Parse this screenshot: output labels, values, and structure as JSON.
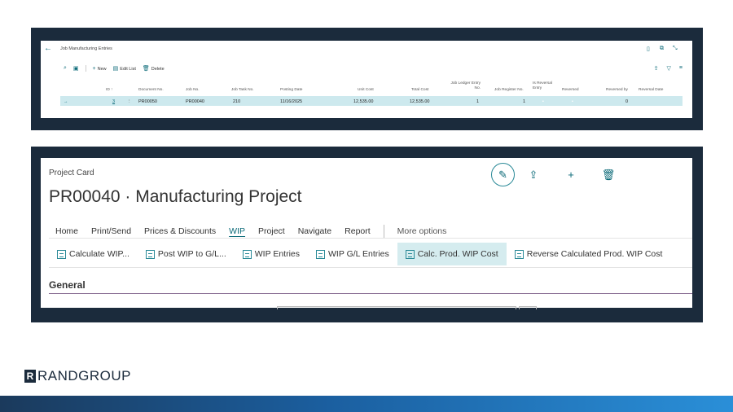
{
  "top": {
    "title": "Job Manufacturing Entries",
    "toolbar": {
      "new_label": "New",
      "edit_list_label": "Edit List",
      "delete_label": "Delete"
    },
    "columns": [
      "ID ↑",
      "Document No.",
      "Job No.",
      "Job Task No.",
      "Posting Date",
      "Unit Cost",
      "Total Cost",
      "Job Ledger Entry No.",
      "Job Register No.",
      "Is Reversal Entry",
      "Reversed",
      "Reversed by",
      "Reversal Date"
    ],
    "row": {
      "id": "3",
      "document_no": "PR00050",
      "job_no": "PR00040",
      "job_task_no": "210",
      "posting_date": "11/16/2025",
      "unit_cost": "12,535.00",
      "total_cost": "12,535.00",
      "ledger_entry_no": "1",
      "register_no": "1",
      "reversed_by": "0"
    }
  },
  "card": {
    "label": "Project Card",
    "title": "PR00040 · Manufacturing Project",
    "menu": [
      "Home",
      "Print/Send",
      "Prices & Discounts",
      "WIP",
      "Project",
      "Navigate",
      "Report"
    ],
    "more_options": "More options",
    "tools": [
      "Calculate WIP...",
      "Post WIP to G/L...",
      "WIP Entries",
      "WIP G/L Entries",
      "Calc. Prod. WIP Cost",
      "Reverse Calculated Prod. WIP Cost"
    ],
    "section": "General"
  },
  "brand": {
    "name": "RANDGROUP",
    "mark": "R"
  },
  "colors": {
    "frame": "#1b2b3c",
    "accent": "#0b6a78",
    "highlight": "#d5ecef"
  }
}
